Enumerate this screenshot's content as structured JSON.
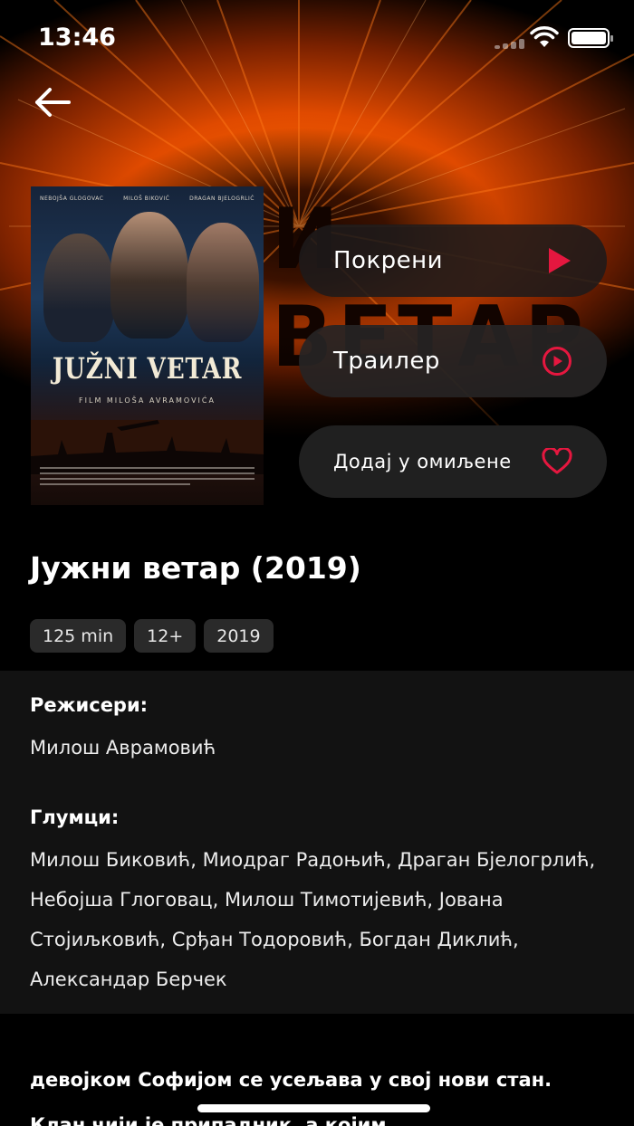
{
  "status_bar": {
    "time": "13:46"
  },
  "hero": {
    "background_title": "И ВЕТАР"
  },
  "poster": {
    "top_credits": [
      "NEBOJŠA GLOGOVAC",
      "MILOŠ BIKOVIĆ",
      "DRAGAN BJELOGRLIĆ"
    ],
    "title": "JUŽNI VETAR",
    "subtitle": "FILM MILOŠA AVRAMOVIĆA"
  },
  "actions": {
    "play_label": "Покрени",
    "trailer_label": "Траилер",
    "favorite_label": "Додај у омиљене"
  },
  "movie": {
    "title": "Јужни ветар (2019)",
    "tags": [
      "125 min",
      "12+",
      "2019"
    ]
  },
  "credits": {
    "directors_heading": "Режисери:",
    "directors": "Милош Аврамовић",
    "actors_heading": "Глумци:",
    "actors": "Милош Биковић, Миодраг Радоњић, Драган Бјелогрлић, Небојша Глоговац, Милош Тимотијевић, Јована Стојиљковић, Срђан Тодоровић, Богдан Диклић, Александар Берчек"
  },
  "description": "девојком Софијом се усељава у свој нови стан. Клан чији је припадник, а којим",
  "colors": {
    "accent": "#e5173f",
    "background": "#000000",
    "section": "#121212"
  }
}
